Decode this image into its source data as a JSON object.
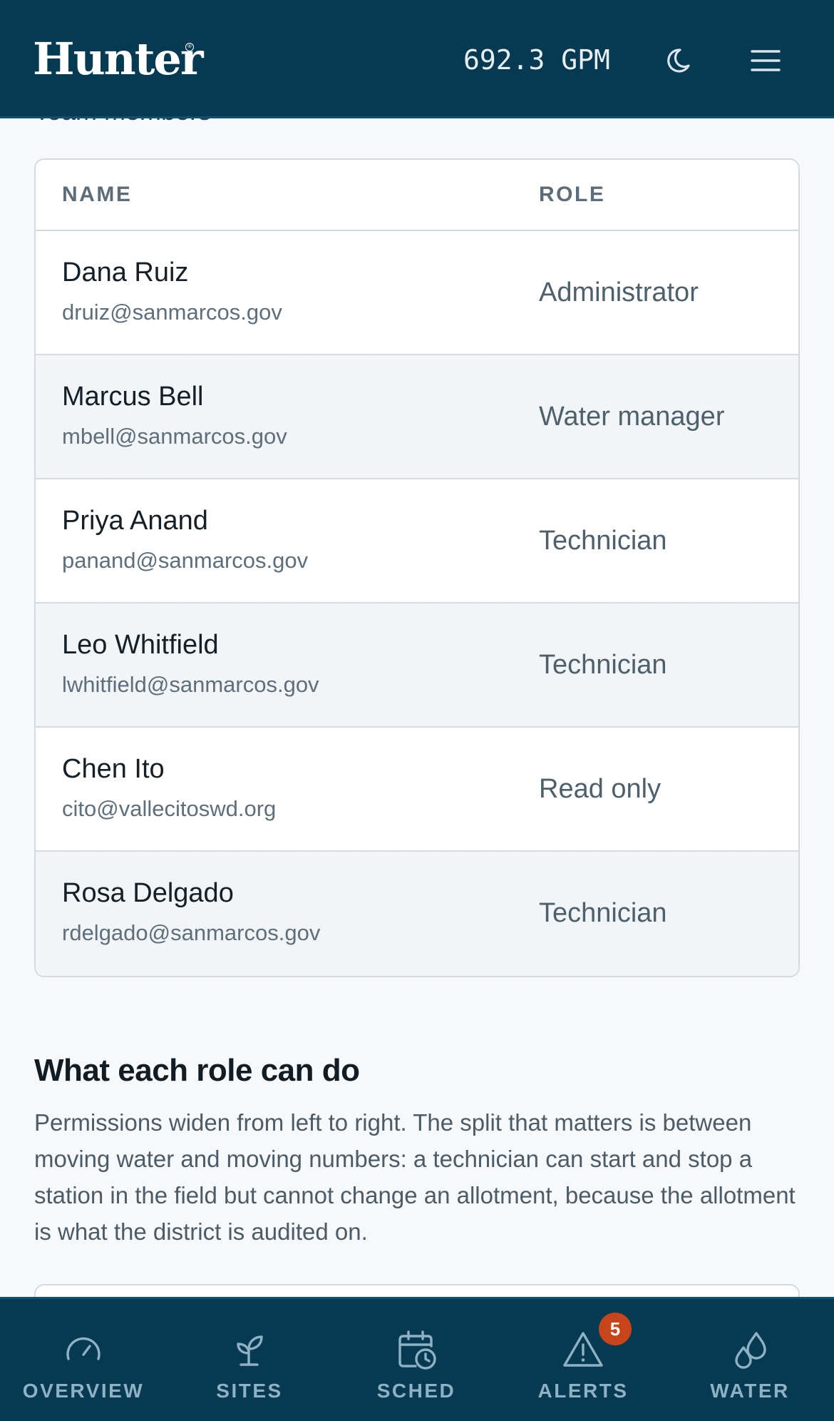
{
  "header": {
    "logo_text": "Hunter",
    "logo_mark": "®",
    "flow_reading": "692.3 GPM",
    "theme_icon": "moon-icon",
    "menu_icon": "hamburger-menu-icon"
  },
  "peek_title": "Team members",
  "users_table": {
    "columns": [
      "NAME",
      "ROLE"
    ],
    "rows": [
      {
        "name": "Dana Ruiz",
        "email": "druiz@sanmarcos.gov",
        "role": "Administrator"
      },
      {
        "name": "Marcus Bell",
        "email": "mbell@sanmarcos.gov",
        "role": "Water manager"
      },
      {
        "name": "Priya Anand",
        "email": "panand@sanmarcos.gov",
        "role": "Technician"
      },
      {
        "name": "Leo Whitfield",
        "email": "lwhitfield@sanmarcos.gov",
        "role": "Technician"
      },
      {
        "name": "Chen Ito",
        "email": "cito@vallecitoswd.org",
        "role": "Read only"
      },
      {
        "name": "Rosa Delgado",
        "email": "rdelgado@sanmarcos.gov",
        "role": "Technician"
      }
    ]
  },
  "roles_section": {
    "title": "What each role can do",
    "body": "Permissions widen from left to right. The split that matters is between moving water and moving numbers: a technician can start and stop a station in the field but cannot change an allotment, because the allotment is what the district is audited on."
  },
  "bottom_nav": {
    "items": [
      {
        "label": "OVERVIEW",
        "icon": "gauge-icon"
      },
      {
        "label": "SITES",
        "icon": "sprout-icon"
      },
      {
        "label": "SCHED",
        "icon": "calendar-clock-icon"
      },
      {
        "label": "ALERTS",
        "icon": "warning-triangle-icon"
      },
      {
        "label": "WATER",
        "icon": "water-drops-icon"
      }
    ],
    "alerts_badge": "5"
  },
  "colors": {
    "header_bg": "#053a52",
    "nav_label": "#8fb1c4",
    "badge": "#c8441a",
    "page_bg": "#f6f8fa"
  }
}
